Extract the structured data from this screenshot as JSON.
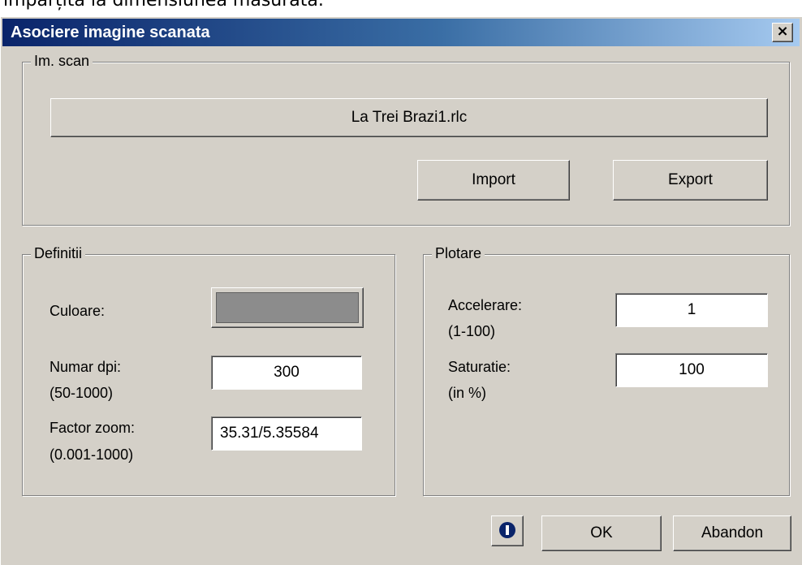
{
  "top_text": "imparțită la dimensiunea măsurată.",
  "window": {
    "title": "Asociere imagine scanata",
    "close_glyph": "×"
  },
  "im_scan": {
    "label": "Im. scan",
    "file_button": "La Trei Brazi1.rlc",
    "import_button": "Import",
    "export_button": "Export"
  },
  "definitii": {
    "label": "Definitii",
    "culoare_label": "Culoare:",
    "culoare_value": "#8c8c8c",
    "dpi_label": "Numar dpi:",
    "dpi_range": "(50-1000)",
    "dpi_value": "300",
    "zoom_label": "Factor zoom:",
    "zoom_range": "(0.001-1000)",
    "zoom_value": "35.31/5.35584"
  },
  "plotare": {
    "label": "Plotare",
    "accel_label": "Accelerare:",
    "accel_range": "(1-100)",
    "accel_value": "1",
    "sat_label": "Saturatie:",
    "sat_range": "(in %)",
    "sat_value": "100"
  },
  "footer": {
    "info_icon": "info-icon",
    "ok_button": "OK",
    "abandon_button": "Abandon"
  }
}
